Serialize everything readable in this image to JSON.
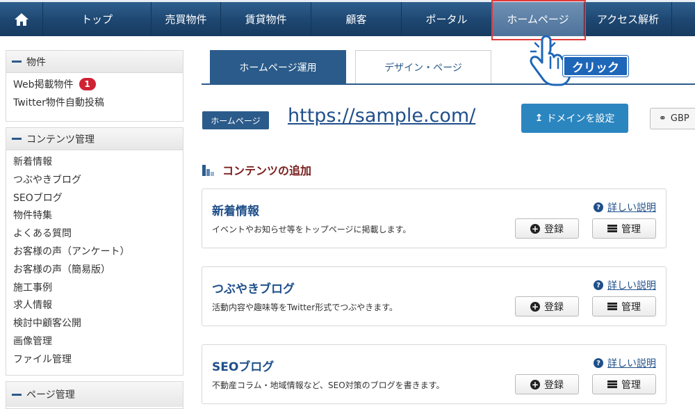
{
  "nav": {
    "home_icon": "home-icon",
    "items": [
      "トップ",
      "売買物件",
      "賃貸物件",
      "顧客",
      "ポータル",
      "ホームページ",
      "アクセス解析"
    ],
    "active": "ホームページ"
  },
  "sidebar": {
    "property": {
      "heading": "物件",
      "items": [
        "Web掲載物件",
        "Twitter物件自動投稿"
      ],
      "badge": "1"
    },
    "contents": {
      "heading": "コンテンツ管理",
      "items": [
        "新着情報",
        "つぶやきブログ",
        "SEOブログ",
        "物件特集",
        "よくある質問",
        "お客様の声（アンケート）",
        "お客様の声（簡易版）",
        "施工事例",
        "求人情報",
        "検討中顧客公開",
        "画像管理",
        "ファイル管理"
      ]
    },
    "page": {
      "heading": "ページ管理"
    }
  },
  "tabs": [
    "ホームページ運用",
    "デザイン・ページ"
  ],
  "annotation": {
    "click_label": "クリック"
  },
  "site": {
    "badge": "ホームページ",
    "url": "https://sample.com/",
    "domain_button": "ドメインを設定",
    "gbp_button": "GBP"
  },
  "section": {
    "title": "コンテンツの追加"
  },
  "cards": [
    {
      "title": "新着情報",
      "desc": "イベントやお知らせ等をトップページに掲載します。",
      "help": "詳しい説明",
      "register": "登録",
      "manage": "管理"
    },
    {
      "title": "つぶやきブログ",
      "desc": "活動内容や趣味等をTwitter形式でつぶやきます。",
      "help": "詳しい説明",
      "register": "登録",
      "manage": "管理"
    },
    {
      "title": "SEOブログ",
      "desc": "不動産コラム・地域情報など、SEO対策のブログを書きます。",
      "help": "詳しい説明",
      "register": "登録",
      "manage": "管理"
    }
  ],
  "colors": {
    "nav": "#1d4670",
    "accent": "#2b5b8a",
    "domain_button": "#2b86c0",
    "badge": "#cf2233",
    "section_title": "#7a1d1d",
    "highlight_frame": "#e23a3a"
  }
}
